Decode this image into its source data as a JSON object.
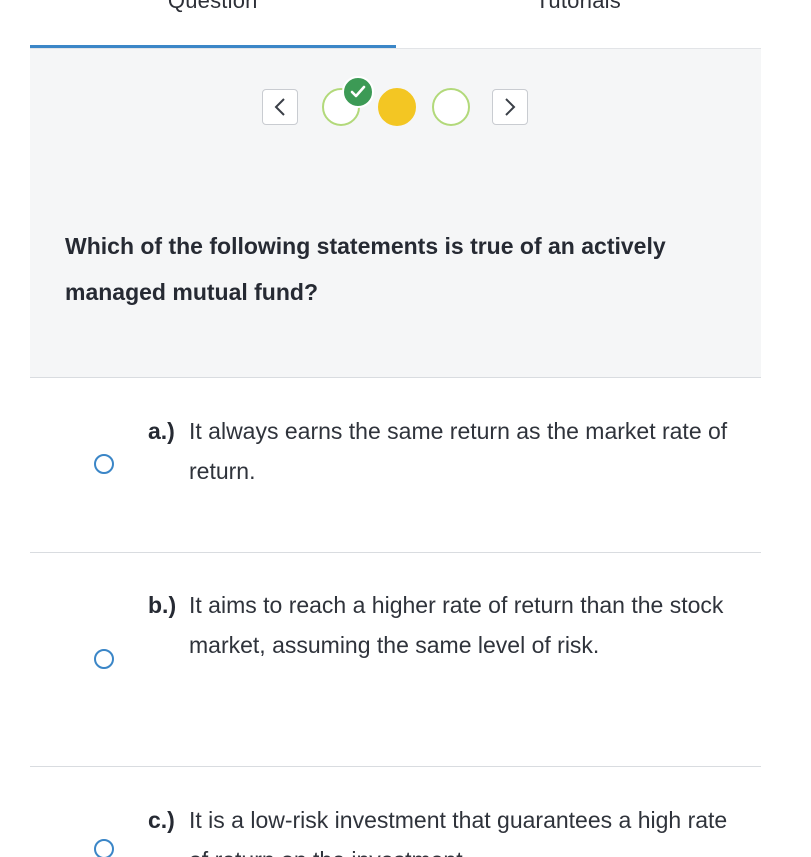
{
  "tabs": [
    {
      "label": "Question",
      "active": true
    },
    {
      "label": "Tutorials",
      "active": false
    }
  ],
  "pager": {
    "prev_icon": "chevron-left-icon",
    "next_icon": "chevron-right-icon",
    "steps": [
      {
        "state": "completed",
        "badge": "check-icon"
      },
      {
        "state": "current"
      },
      {
        "state": "unanswered"
      }
    ]
  },
  "question": {
    "text": "Which of the following statements is true of an actively managed mutual fund?"
  },
  "options": [
    {
      "letter": "a.)",
      "text": "It always earns the same return as the market rate of return."
    },
    {
      "letter": "b.)",
      "text": "It aims to reach a higher rate of return than the stock market, assuming the same level of risk."
    },
    {
      "letter": "c.)",
      "text": "It is a low-risk investment that guarantees a high rate of return on the investment."
    }
  ],
  "colors": {
    "accent": "#3b86c7",
    "current_step": "#f3c623",
    "completed_ring": "#b2d97a",
    "check_badge": "#3c9a55",
    "panel_background": "#f5f6f7"
  }
}
